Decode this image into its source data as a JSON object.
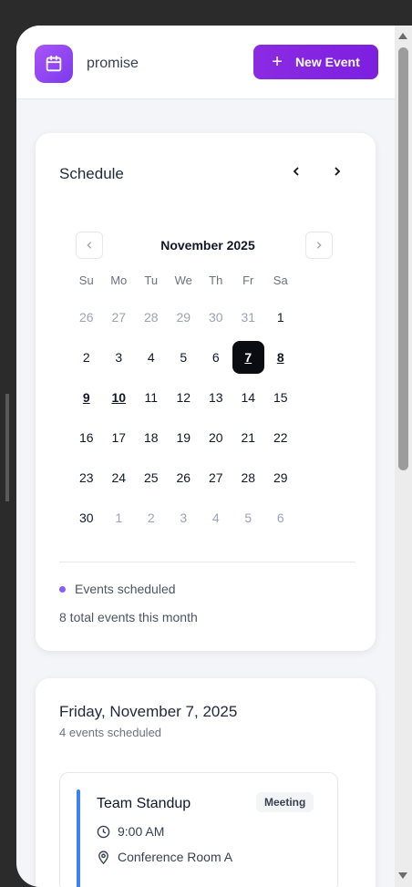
{
  "header": {
    "app_name": "promise",
    "new_event_label": "New Event",
    "new_event_icon": "+",
    "logo_icon": "calendar-icon",
    "accent": "#7c3aed"
  },
  "schedule": {
    "title": "Schedule",
    "prev_arrow": "‹",
    "next_arrow": "›",
    "month_label": "November 2025",
    "weekdays": [
      "Su",
      "Mo",
      "Tu",
      "We",
      "Th",
      "Fr",
      "Sa"
    ],
    "weeks": [
      [
        {
          "d": "26",
          "out": true
        },
        {
          "d": "27",
          "out": true
        },
        {
          "d": "28",
          "out": true
        },
        {
          "d": "29",
          "out": true
        },
        {
          "d": "30",
          "out": true
        },
        {
          "d": "31",
          "out": true
        },
        {
          "d": "1"
        }
      ],
      [
        {
          "d": "2"
        },
        {
          "d": "3"
        },
        {
          "d": "4"
        },
        {
          "d": "5"
        },
        {
          "d": "6"
        },
        {
          "d": "7",
          "selected": true
        },
        {
          "d": "8",
          "event": true
        }
      ],
      [
        {
          "d": "9",
          "event": true
        },
        {
          "d": "10",
          "event": true
        },
        {
          "d": "11"
        },
        {
          "d": "12"
        },
        {
          "d": "13"
        },
        {
          "d": "14"
        },
        {
          "d": "15"
        }
      ],
      [
        {
          "d": "16"
        },
        {
          "d": "17"
        },
        {
          "d": "18"
        },
        {
          "d": "19"
        },
        {
          "d": "20"
        },
        {
          "d": "21"
        },
        {
          "d": "22"
        }
      ],
      [
        {
          "d": "23"
        },
        {
          "d": "24"
        },
        {
          "d": "25"
        },
        {
          "d": "26"
        },
        {
          "d": "27"
        },
        {
          "d": "28"
        },
        {
          "d": "29"
        }
      ],
      [
        {
          "d": "30"
        },
        {
          "d": "1",
          "out": true
        },
        {
          "d": "2",
          "out": true
        },
        {
          "d": "3",
          "out": true
        },
        {
          "d": "4",
          "out": true
        },
        {
          "d": "5",
          "out": true
        },
        {
          "d": "6",
          "out": true
        }
      ]
    ],
    "legend_label": "Events scheduled",
    "legend_color": "#8b5cf6",
    "total_text": "8 total events this month"
  },
  "day": {
    "title": "Friday, November 7, 2025",
    "subtitle": "4 events scheduled",
    "events": [
      {
        "title": "Team Standup",
        "badge": "Meeting",
        "time": "9:00 AM",
        "location": "Conference Room A",
        "color": "#3b82f6"
      }
    ]
  }
}
